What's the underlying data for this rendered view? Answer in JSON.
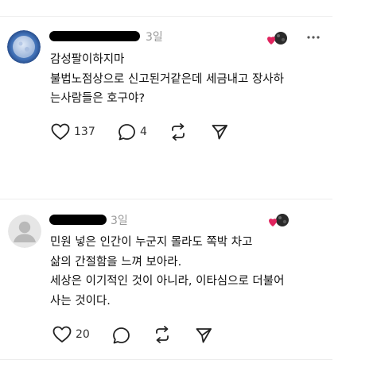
{
  "posts": [
    {
      "time": "3일",
      "lines": [
        "감성팔이하지마",
        "불법노점상으로 신고된거같은데 세금내고 장사하",
        "는사람들은 호구야?"
      ],
      "actions": {
        "like_count": "137",
        "reply_count": "4"
      }
    },
    {
      "time": "3일",
      "lines": [
        "민원 넣은 인간이 누군지 몰라도 쪽박 차고",
        "삶의 간절함을 느껴 보아라.",
        "세상은 이기적인 것이 아니라, 이타심으로 더불어",
        "사는 것이다."
      ],
      "actions": {
        "like_count": "20",
        "reply_count": ""
      }
    }
  ],
  "icons": {
    "avatar_1": "moon-avatar",
    "avatar_2": "default-person-avatar",
    "reaction": "heart-with-avatar-icon",
    "more": "more-dots-icon",
    "like": "heart-icon",
    "reply": "comment-bubble-icon",
    "repost": "repost-icon",
    "share": "send-icon"
  },
  "colors": {
    "heart_red": "#e0245e",
    "muted_text": "#9a9a9a",
    "redaction": "#000000"
  }
}
